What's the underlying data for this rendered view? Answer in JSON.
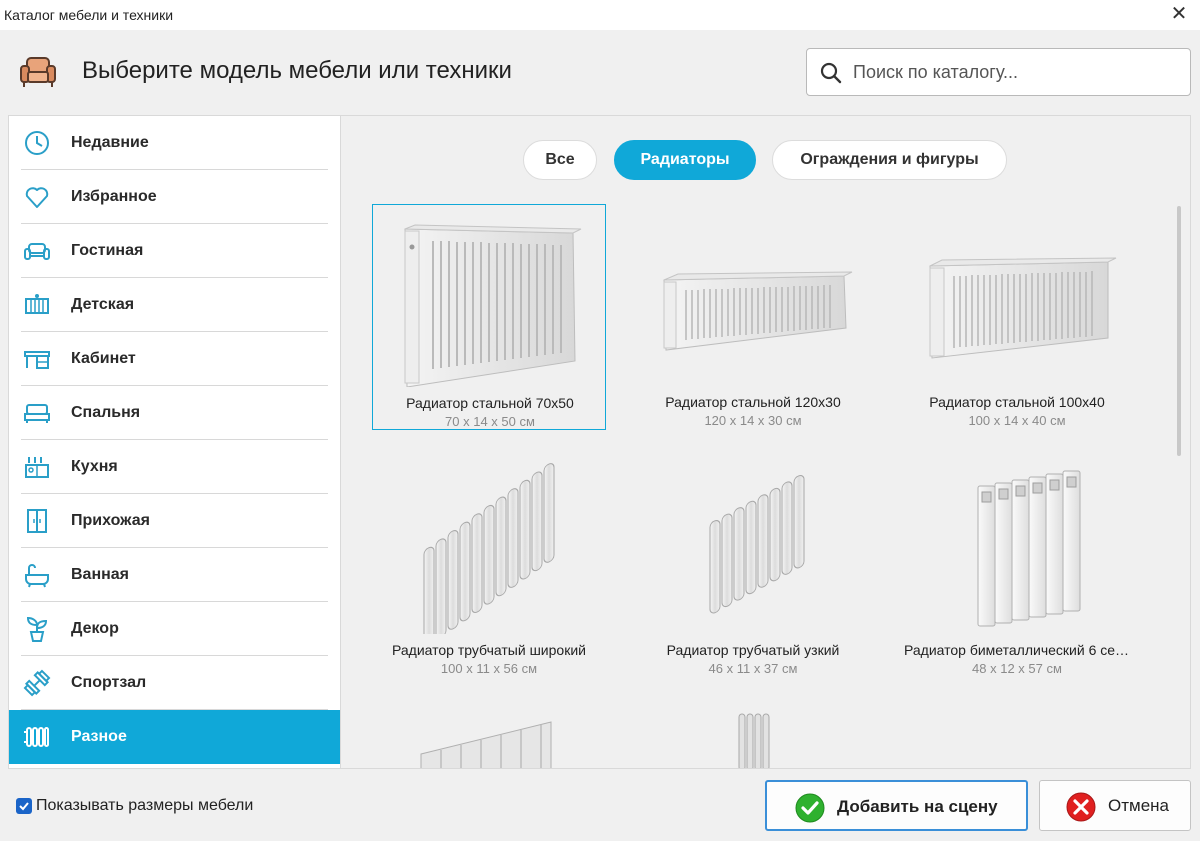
{
  "window": {
    "title": "Каталог мебели и техники",
    "close_glyph": "✕"
  },
  "header": {
    "logo_icon": "armchair-icon",
    "title": "Выберите модель мебели или техники",
    "search_placeholder": "Поиск по каталогу..."
  },
  "sidebar": {
    "items": [
      {
        "label": "Недавние",
        "icon": "clock-icon"
      },
      {
        "label": "Избранное",
        "icon": "heart-icon"
      },
      {
        "label": "Гостиная",
        "icon": "sofa-icon"
      },
      {
        "label": "Детская",
        "icon": "crib-icon"
      },
      {
        "label": "Кабинет",
        "icon": "desk-icon"
      },
      {
        "label": "Спальня",
        "icon": "bed-icon"
      },
      {
        "label": "Кухня",
        "icon": "kitchen-icon"
      },
      {
        "label": "Прихожая",
        "icon": "wardrobe-icon"
      },
      {
        "label": "Ванная",
        "icon": "bathtub-icon"
      },
      {
        "label": "Декор",
        "icon": "plant-icon"
      },
      {
        "label": "Спортзал",
        "icon": "dumbbell-icon"
      },
      {
        "label": "Разное",
        "icon": "radiator-icon",
        "active": true
      }
    ]
  },
  "filters": [
    {
      "label": "Все"
    },
    {
      "label": "Радиаторы",
      "active": true
    },
    {
      "label": "Ограждения и фигуры"
    }
  ],
  "items": [
    {
      "name": "Радиатор стальной 70x50",
      "dims": "70 x 14 x 50 см",
      "selected": true
    },
    {
      "name": "Радиатор стальной 120x30",
      "dims": "120 x 14 x 30 см"
    },
    {
      "name": "Радиатор стальной 100x40",
      "dims": "100 x 14 x 40 см"
    },
    {
      "name": "Радиатор трубчатый широкий",
      "dims": "100 x 11 x 56 см"
    },
    {
      "name": "Радиатор трубчатый узкий",
      "dims": "46 x 11 x 37 см"
    },
    {
      "name": "Радиатор биметаллический 6 сек...",
      "dims": "48 x 12 x 57 см"
    }
  ],
  "footer": {
    "show_dimensions_label": "Показывать размеры мебели",
    "show_dimensions_checked": true,
    "add_button": "Добавить на сцену",
    "cancel_button": "Отмена"
  },
  "colors": {
    "accent": "#10a8d8",
    "checkbox": "#1a64c8",
    "ok": "#2fb12f",
    "cancel": "#e02020"
  }
}
